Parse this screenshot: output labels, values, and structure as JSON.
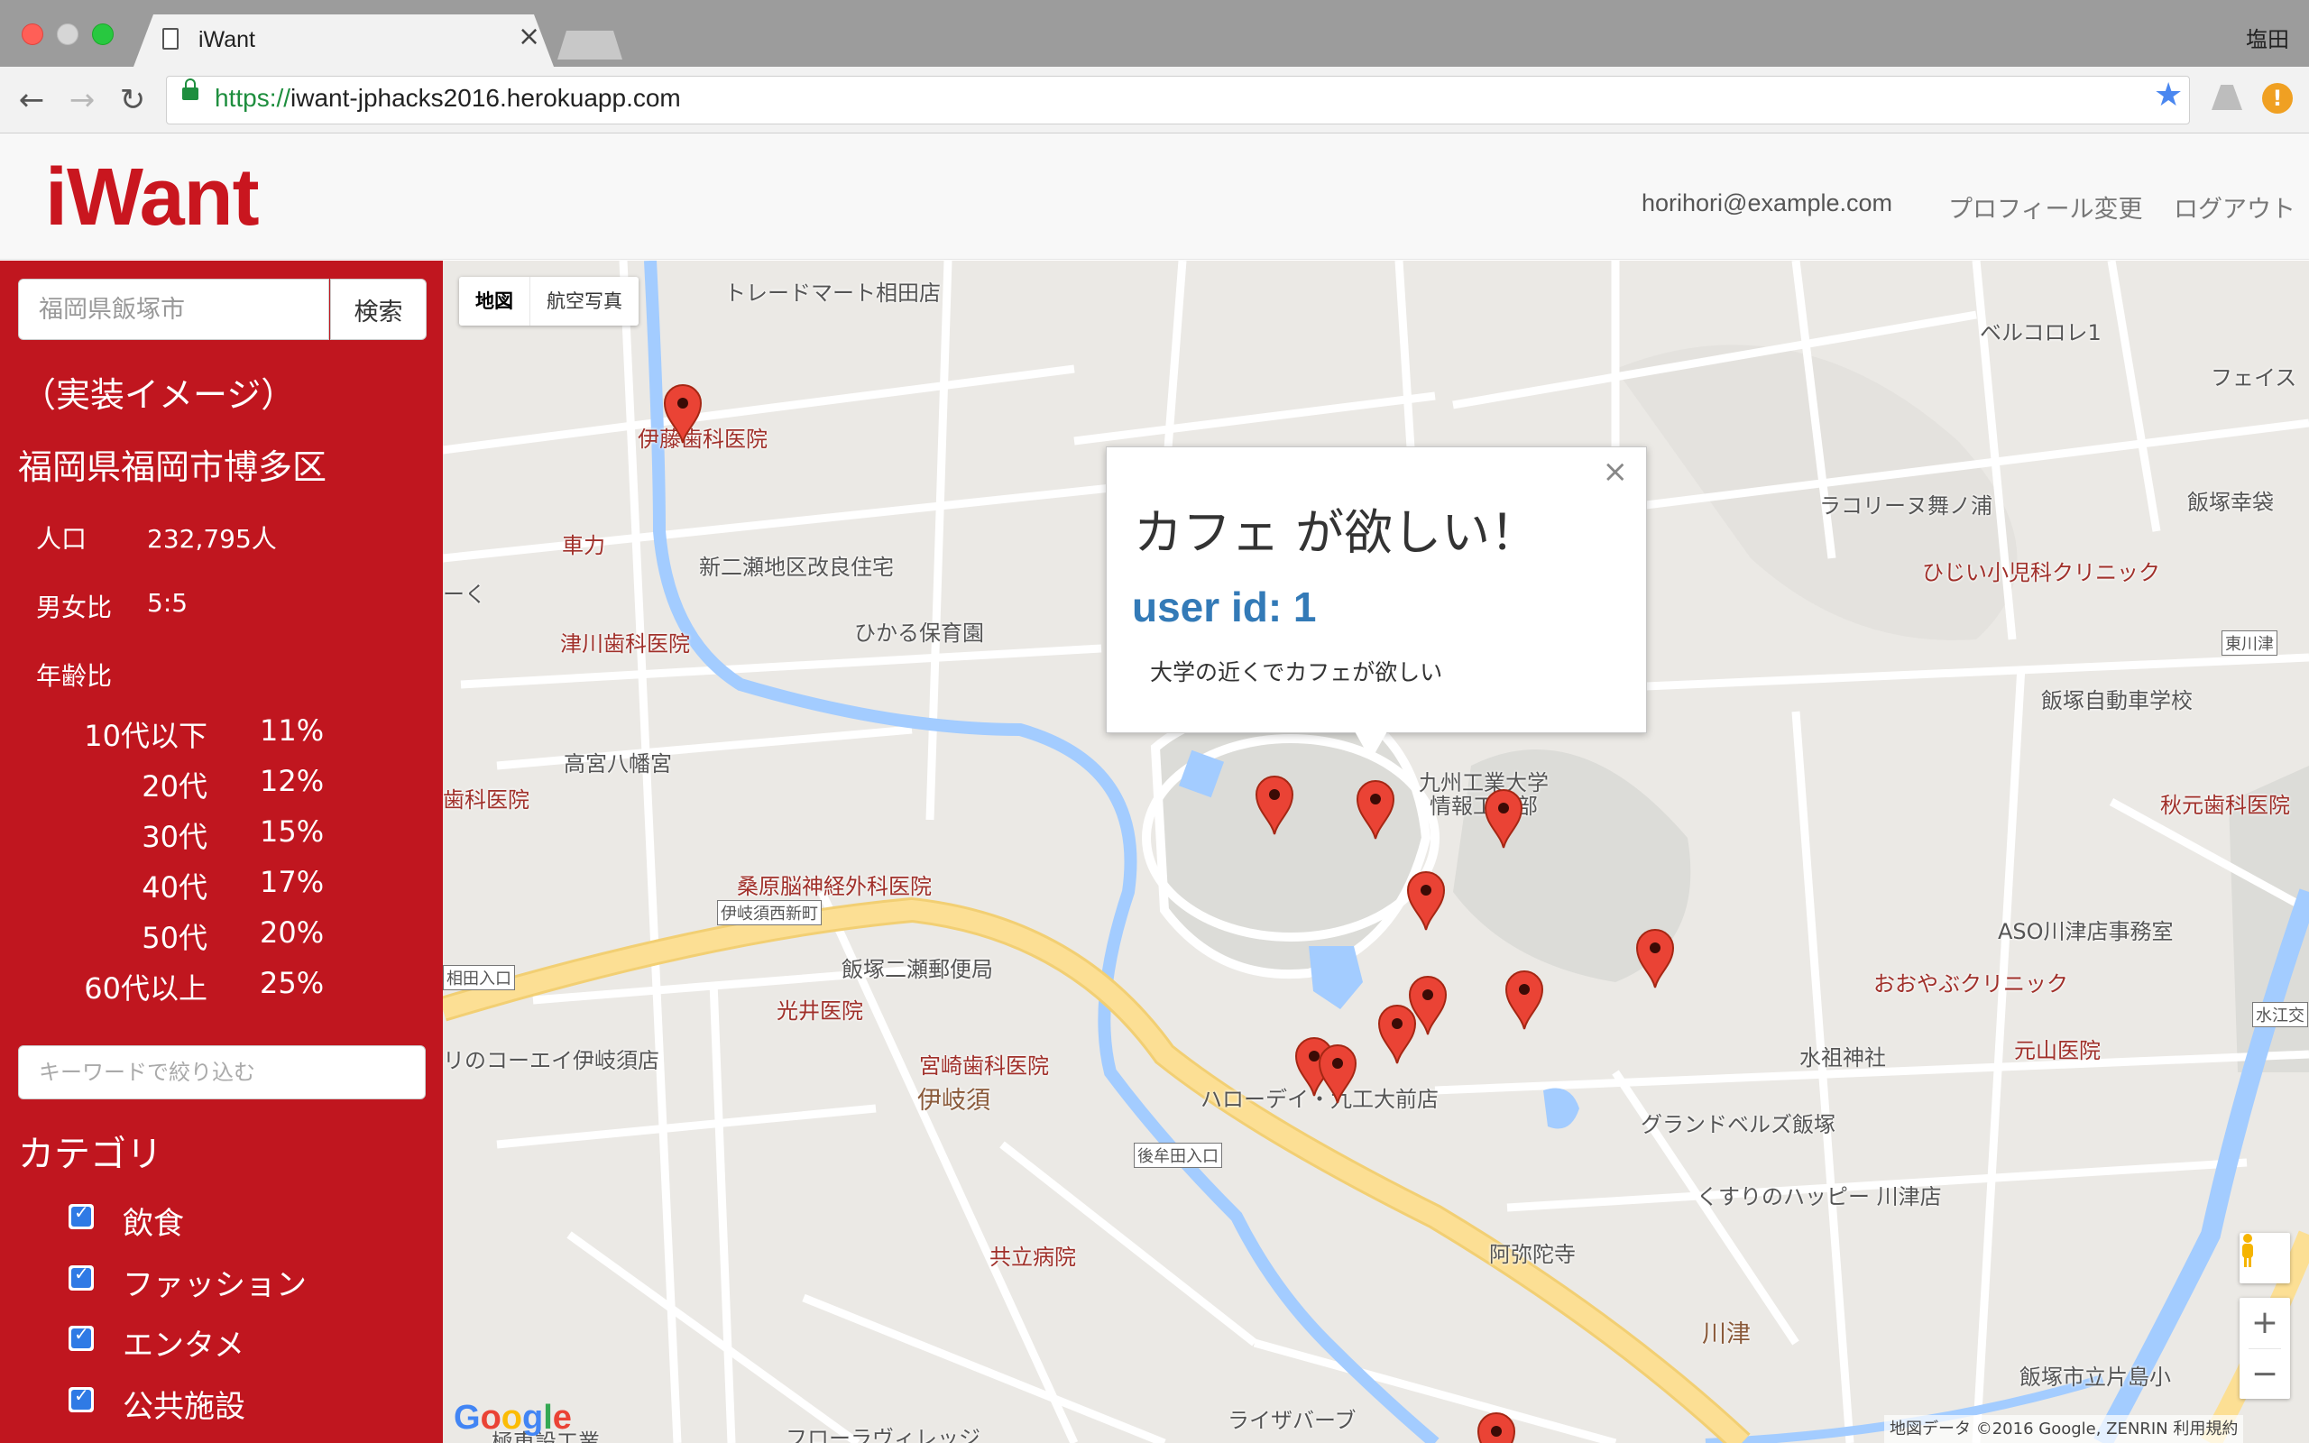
{
  "browser": {
    "tab_title": "iWant",
    "tab_close": "×",
    "profile_name": "塩田",
    "url_scheme": "https://",
    "url_host": "iwant-jphacks2016.herokuapp.com"
  },
  "header": {
    "brand": "iWant",
    "user_email": "horihori@example.com",
    "profile_link": "プロフィール変更",
    "logout_link": "ログアウト"
  },
  "sidebar": {
    "search_placeholder": "福岡県飯塚市",
    "search_button": "検索",
    "note": "（実装イメージ）",
    "region": "福岡県福岡市博多区",
    "population_label": "人口",
    "population_value": "232,795人",
    "gender_label": "男女比",
    "gender_value": "5:5",
    "age_title": "年齢比",
    "age_groups": [
      {
        "label": "10代以下",
        "pct": "11%"
      },
      {
        "label": "20代",
        "pct": "12%"
      },
      {
        "label": "30代",
        "pct": "15%"
      },
      {
        "label": "40代",
        "pct": "17%"
      },
      {
        "label": "50代",
        "pct": "20%"
      },
      {
        "label": "60代以上",
        "pct": "25%"
      }
    ],
    "keyword_placeholder": "キーワードで絞り込む",
    "category_title": "カテゴリ",
    "categories": [
      {
        "label": "飲食",
        "checked": true
      },
      {
        "label": "ファッション",
        "checked": true
      },
      {
        "label": "エンタメ",
        "checked": true
      },
      {
        "label": "公共施設",
        "checked": true
      }
    ],
    "check_mark": "✓"
  },
  "map": {
    "type_map": "地図",
    "type_satellite": "航空写真",
    "labels": {
      "trademart": "トレードマート相田店",
      "ito_dental": "伊藤歯科医院",
      "sharyoku": "車力",
      "shinnise": "新二瀬地区改良住宅",
      "ku": "ーく",
      "tsugawa_dental": "津川歯科医院",
      "hikaru": "ひかる保育園",
      "takamiya": "高宮八幡宮",
      "ka_clinic": "歯科医院",
      "kuwahara": "桑原脳神経外科医院",
      "ikisu_nishi": "伊岐須西新町",
      "futase_post": "飯塚二瀬郵便局",
      "aida_iriguchi": "相田入口",
      "mitsui": "光井医院",
      "koei": "リのコーエイ伊岐須店",
      "miyazaki": "宮崎歯科医院",
      "ikisu": "伊岐須",
      "halloday": "ハローデイ・九工大前店",
      "gomuta": "後牟田入口",
      "kyoritsu": "共立病院",
      "raizaburu": "ライザバーブ",
      "flora": "フローラヴィレッジ",
      "kyushu_univ": "九州工業大学\n情報工学部",
      "bell": "ベルコロレ1",
      "face": "フェイス",
      "lacolina": "ラコリーヌ舞ノ浦",
      "iizuka_kosai": "飯塚幸袋",
      "hijii": "ひじい小児科クリニック",
      "higashikawa": "東川津",
      "driving_school": "飯塚自動車学校",
      "akimoto": "秋元歯科医院",
      "aso": "ASO川津店事務室",
      "ooyabu": "おおやぶクリニック",
      "suiso": "水祖神社",
      "motoyama": "元山医院",
      "mizue": "水江交",
      "grandbell": "グランドベルズ飯塚",
      "happy": "くすりのハッピー 川津店",
      "amidaji": "阿弥陀寺",
      "kawazu": "川津",
      "katashima": "飯塚市立片島小",
      "engineering": "極東設工業"
    },
    "infowindow": {
      "close": "×",
      "title": "カフェ が欲しい！",
      "user": "user id: 1",
      "body": "大学の近くでカフェが欲しい"
    },
    "zoom_in": "+",
    "zoom_out": "−",
    "google_logo": "Google",
    "attribution": "地図データ ©2016 Google, ZENRIN    利用規約",
    "colors": {
      "pin": "#ea4335",
      "water": "#a3ccff",
      "highway": "#fcdf94",
      "park": "#dcdcd8"
    }
  }
}
